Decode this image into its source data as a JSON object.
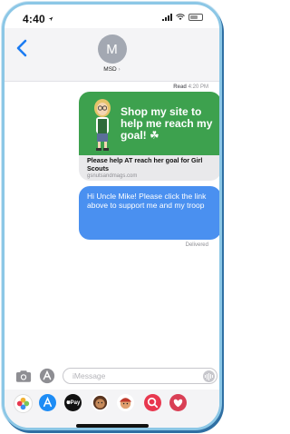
{
  "status_bar": {
    "time": "4:40"
  },
  "header": {
    "avatar_initial": "M",
    "contact_name": "MSD",
    "contact_chevron": "›"
  },
  "thread": {
    "read_receipt": {
      "prefix": "Read",
      "time": "4:20 PM"
    },
    "link_preview": {
      "image_text": "Shop my site to help me reach my goal! ☘",
      "title": "Please help AT reach her goal for Girl Scouts",
      "domain": "gsnutsandmags.com"
    },
    "outgoing_message": "Hi Uncle Mike! Please click the link above to support me and my troop",
    "delivery_status": "Delivered"
  },
  "composer": {
    "placeholder": "iMessage"
  },
  "app_drawer": {
    "apps": [
      {
        "name": "Photos",
        "icon": "photos-icon",
        "color": "#f2b134"
      },
      {
        "name": "App Store",
        "icon": "app-store-icon",
        "color": "#1d8cf5"
      },
      {
        "name": "Apple Pay",
        "label": "Pay",
        "icon": "apple-pay-icon",
        "color": "#111111"
      },
      {
        "name": "Memoji 1",
        "icon": "memoji-icon",
        "color": "#c78a5a"
      },
      {
        "name": "Memoji 2",
        "icon": "memoji-icon",
        "color": "#e08c3a"
      },
      {
        "name": "Search",
        "icon": "search-icon",
        "color": "#e8384f"
      },
      {
        "name": "Digital Touch",
        "icon": "heart-icon",
        "color": "#d93f55"
      }
    ]
  },
  "colors": {
    "accent": "#4a90f0",
    "link_image_bg": "#3da14e",
    "frame": "#8cc7e6"
  }
}
